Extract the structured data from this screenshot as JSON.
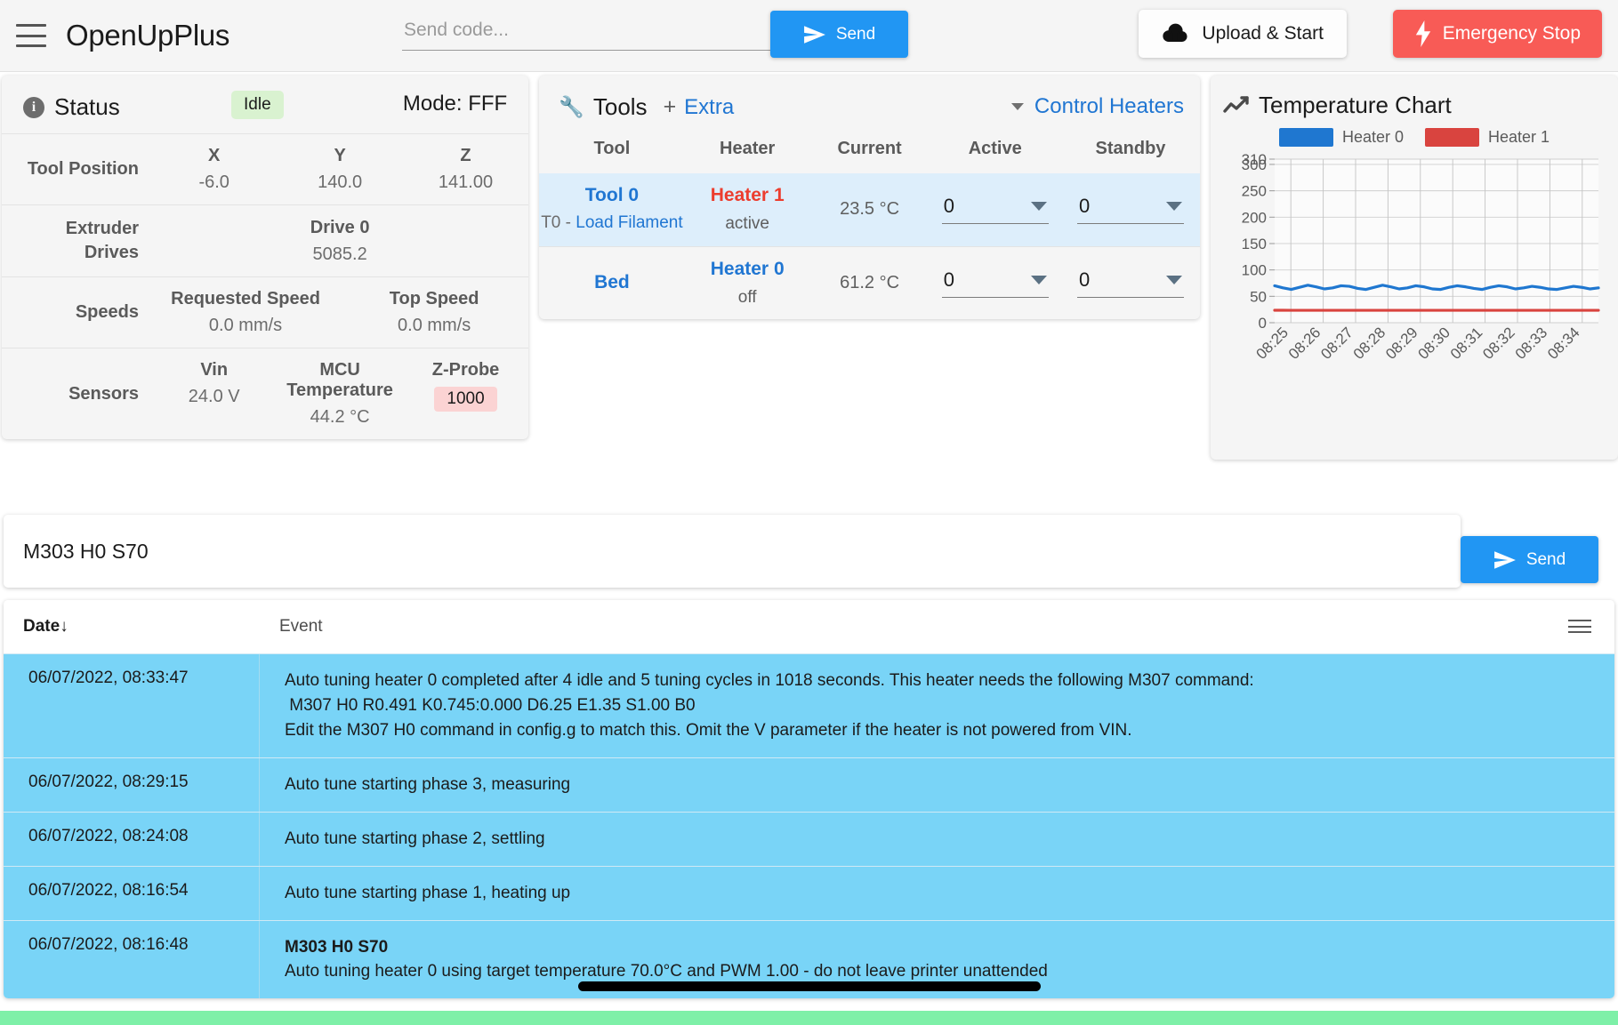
{
  "header": {
    "menu_icon": "hamburger-icon",
    "brand": "OpenUpPlus",
    "send_code_placeholder": "Send code...",
    "send_code_value": "",
    "send_button": "Send",
    "upload_button": "Upload & Start",
    "emergency_button": "Emergency Stop",
    "accent_blue": "#2196f3",
    "danger_red": "#f85b56"
  },
  "status": {
    "title": "Status",
    "badge": "Idle",
    "mode": "Mode: FFF",
    "rows": [
      {
        "label": "Tool Position",
        "cells": [
          {
            "head": "X",
            "value": "-6.0"
          },
          {
            "head": "Y",
            "value": "140.0"
          },
          {
            "head": "Z",
            "value": "141.00"
          }
        ]
      },
      {
        "label": "Extruder Drives",
        "cells": [
          {
            "head": "Drive 0",
            "value": "5085.2"
          }
        ]
      },
      {
        "label": "Speeds",
        "cells": [
          {
            "head": "Requested Speed",
            "value": "0.0 mm/s"
          },
          {
            "head": "Top Speed",
            "value": "0.0 mm/s"
          }
        ]
      },
      {
        "label": "Sensors",
        "cells": [
          {
            "head": "Vin",
            "value": "24.0 V"
          },
          {
            "head": "MCU Temperature",
            "value": "44.2 °C"
          },
          {
            "head": "Z-Probe",
            "value": "1000",
            "pill": true
          }
        ]
      }
    ]
  },
  "tools": {
    "title": "Tools",
    "plus": "+",
    "extra_link": "Extra",
    "control_heaters_link": "Control Heaters",
    "columns": [
      "Tool",
      "Heater",
      "Current",
      "Active",
      "Standby"
    ],
    "rows": [
      {
        "tool": "Tool 0",
        "tool_sub_prefix": "T0 - ",
        "tool_sub_link": "Load Filament",
        "heater": "Heater 1",
        "heater_color": "red",
        "heater_state": "active",
        "current": "23.5 °C",
        "active": "0",
        "standby": "0",
        "highlight": true
      },
      {
        "tool": "Bed",
        "tool_sub_prefix": "",
        "tool_sub_link": "",
        "heater": "Heater 0",
        "heater_color": "blue",
        "heater_state": "off",
        "current": "61.2 °C",
        "active": "0",
        "standby": "0",
        "highlight": false
      }
    ]
  },
  "chart": {
    "title": "Temperature Chart"
  },
  "chart_data": {
    "type": "line",
    "title": "Temperature Chart",
    "xlabel": "",
    "ylabel": "",
    "ylim": [
      0,
      310
    ],
    "yticks": [
      0,
      50,
      100,
      150,
      200,
      250,
      300,
      310
    ],
    "ytick_labels": [
      "0",
      "50",
      "100",
      "150",
      "200",
      "250",
      "300",
      "310"
    ],
    "grid": true,
    "legend_position": "top",
    "x": [
      "08:25",
      "08:26",
      "08:27",
      "08:28",
      "08:29",
      "08:30",
      "08:31",
      "08:32",
      "08:33",
      "08:34"
    ],
    "series": [
      {
        "name": "Heater 0",
        "color": "#1f77d0",
        "values": [
          70,
          66,
          63,
          67,
          71,
          68,
          64,
          66,
          70,
          69,
          65,
          63,
          67,
          71,
          68,
          64,
          66,
          70,
          68,
          64,
          63,
          67,
          70,
          68,
          65,
          63,
          67,
          70,
          68,
          64,
          66,
          69,
          67,
          64,
          63,
          66,
          69,
          67,
          64,
          66
        ]
      },
      {
        "name": "Heater 1",
        "color": "#d9443f",
        "values": [
          23.6,
          23.6,
          23.5,
          23.5,
          23.5,
          23.5,
          23.5,
          23.5,
          23.5,
          23.5,
          23.5,
          23.5,
          23.5,
          23.5,
          23.5,
          23.5,
          23.5,
          23.5,
          23.5,
          23.5,
          23.5,
          23.5,
          23.5,
          23.5,
          23.5,
          23.5,
          23.5,
          23.5,
          23.5,
          23.5,
          23.5,
          23.5,
          23.5,
          23.5,
          23.5,
          23.5,
          23.5,
          23.5,
          23.5,
          23.5
        ]
      }
    ]
  },
  "console": {
    "input_value": "M303 H0 S70",
    "input_placeholder": "Send code...",
    "send_button": "Send"
  },
  "log": {
    "col_date": "Date",
    "sort_arrow": "↓",
    "col_event": "Event",
    "rows": [
      {
        "date": "06/07/2022, 08:33:47",
        "bold": "",
        "event": "Auto tuning heater 0 completed after 4 idle and 5 tuning cycles in 1018 seconds. This heater needs the following M307 command:\n M307 H0 R0.491 K0.745:0.000 D6.25 E1.35 S1.00 B0\nEdit the M307 H0 command in config.g to match this. Omit the V parameter if the heater is not powered from VIN."
      },
      {
        "date": "06/07/2022, 08:29:15",
        "bold": "",
        "event": "Auto tune starting phase 3, measuring"
      },
      {
        "date": "06/07/2022, 08:24:08",
        "bold": "",
        "event": "Auto tune starting phase 2, settling"
      },
      {
        "date": "06/07/2022, 08:16:54",
        "bold": "",
        "event": "Auto tune starting phase 1, heating up"
      },
      {
        "date": "06/07/2022, 08:16:48",
        "bold": "M303 H0 S70",
        "event": "Auto tuning heater 0 using target temperature 70.0°C and PWM 1.00 - do not leave printer unattended"
      }
    ]
  }
}
